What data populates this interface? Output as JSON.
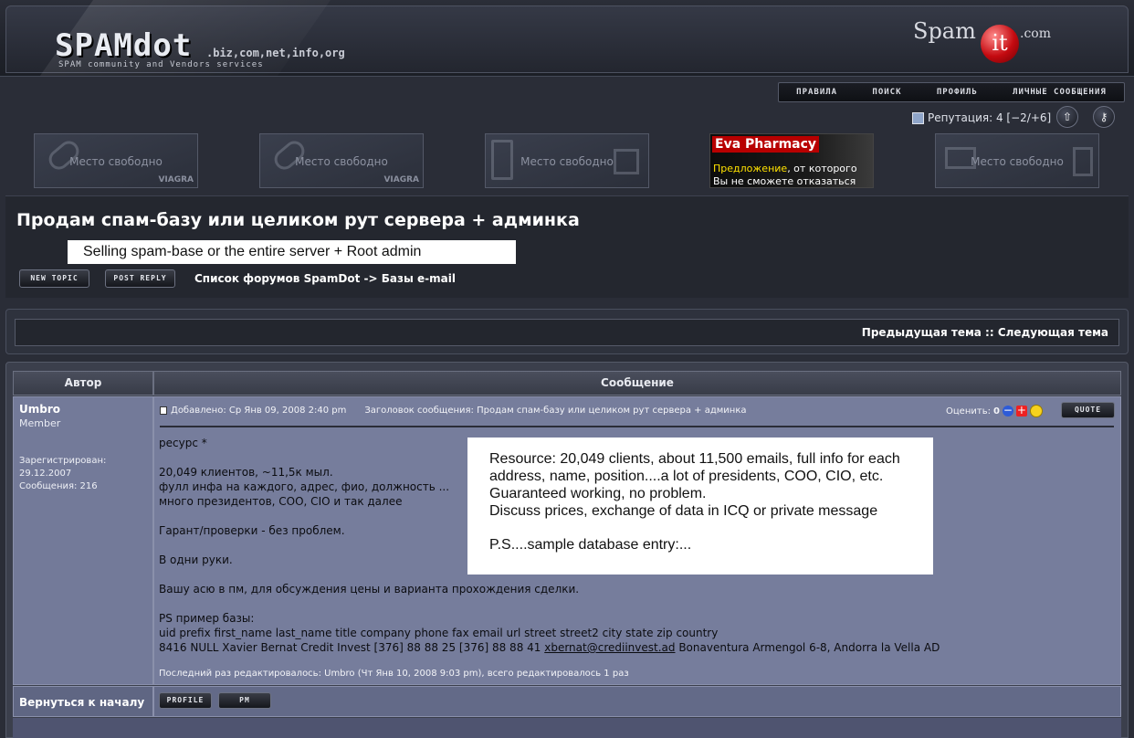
{
  "header": {
    "logo_main": "SPAMdot",
    "logo_tld": ".biz,com,net,info,org",
    "logo_sub": "SPAM community and Vendors services",
    "spamit_word1": "Spam",
    "spamit_word2": "it",
    "spamit_word3": ".com"
  },
  "nav": {
    "rules": "ПРАВИЛА",
    "search": "ПОИСК",
    "profile": "ПРОФИЛЬ",
    "messages": "ЛИЧНЫЕ СООБЩЕНИЯ"
  },
  "reputation": {
    "text": "Репутация: 4 [−2/+6]"
  },
  "ads": {
    "free_label": "Место свободно",
    "viagra_tag": "VIAGRA",
    "eva_title": "Eva Pharmacy",
    "eva_line1a": "Предложение",
    "eva_line1b": ", от которого",
    "eva_line2": "Вы не сможете отказаться"
  },
  "topic": {
    "title": "Продам спам-базу или целиком рут сервера + админка",
    "translation": "Selling spam-base or the entire server + Root admin"
  },
  "buttons": {
    "new_topic": "NEW TOPIC",
    "post_reply": "POST REPLY",
    "quote": "QUOTE",
    "profile": "PROFILE",
    "pm": "PM"
  },
  "breadcrumb": {
    "forum_index": "Список форумов SpamDot",
    "separator": " -> ",
    "forum": "Базы e-mail"
  },
  "prevnext": {
    "prev": "Предыдущая тема",
    "separator": " :: ",
    "next": "Следующая тема"
  },
  "table": {
    "col_author": "Автор",
    "col_message": "Сообщение",
    "back_to_top": "Вернуться к началу"
  },
  "post": {
    "author": "Umbro",
    "rank": "Member",
    "registered_label": "Зарегистрирован:",
    "registered_date": "29.12.2007",
    "messages": "Сообщения: 216",
    "posted": "Добавлено: Ср Янв 09, 2008 2:40 pm",
    "subject": "Заголовок сообщения: Продам спам-базу или целиком рут сервера + админка",
    "rate_label": "Оценить:",
    "rate_value": "0",
    "body": {
      "l1": "ресурс *",
      "l2": "20,049 клиентов, ~11,5к мыл.",
      "l3": "фулл инфа на каждого, адрес, фио, должность ...",
      "l4": "много президентов, COO, CIO и так далее",
      "l5": "Гарант/проверки - без проблем.",
      "l6": "В одни руки.",
      "l7": "Вашу асю в пм, для обсуждения цены и варианта прохождения сделки.",
      "l8": "PS пример базы:",
      "l9": "uid prefix first_name last_name title company phone fax email url street street2 city state zip country",
      "l10a": "8416 NULL Xavier Bernat Credit Invest [376] 88 88 25 [376] 88 88 41 ",
      "l10_email": "xbernat@crediinvest.ad",
      "l10b": " Bonaventura Armengol 6-8, Andorra la Vella AD"
    },
    "edited": "Последний раз редактировалось: Umbro (Чт Янв 10, 2008 9:03 pm), всего редактировалось 1 раз"
  },
  "translation_box": {
    "l1": "Resource: 20,049 clients, about 11,500 emails, full info for each",
    "l2": "address, name, position....a lot of presidents, COO, CIO, etc.",
    "l3": "Guaranteed working, no problem.",
    "l4": "Discuss prices, exchange of data in ICQ or private message",
    "l5": "P.S....sample database entry:..."
  }
}
